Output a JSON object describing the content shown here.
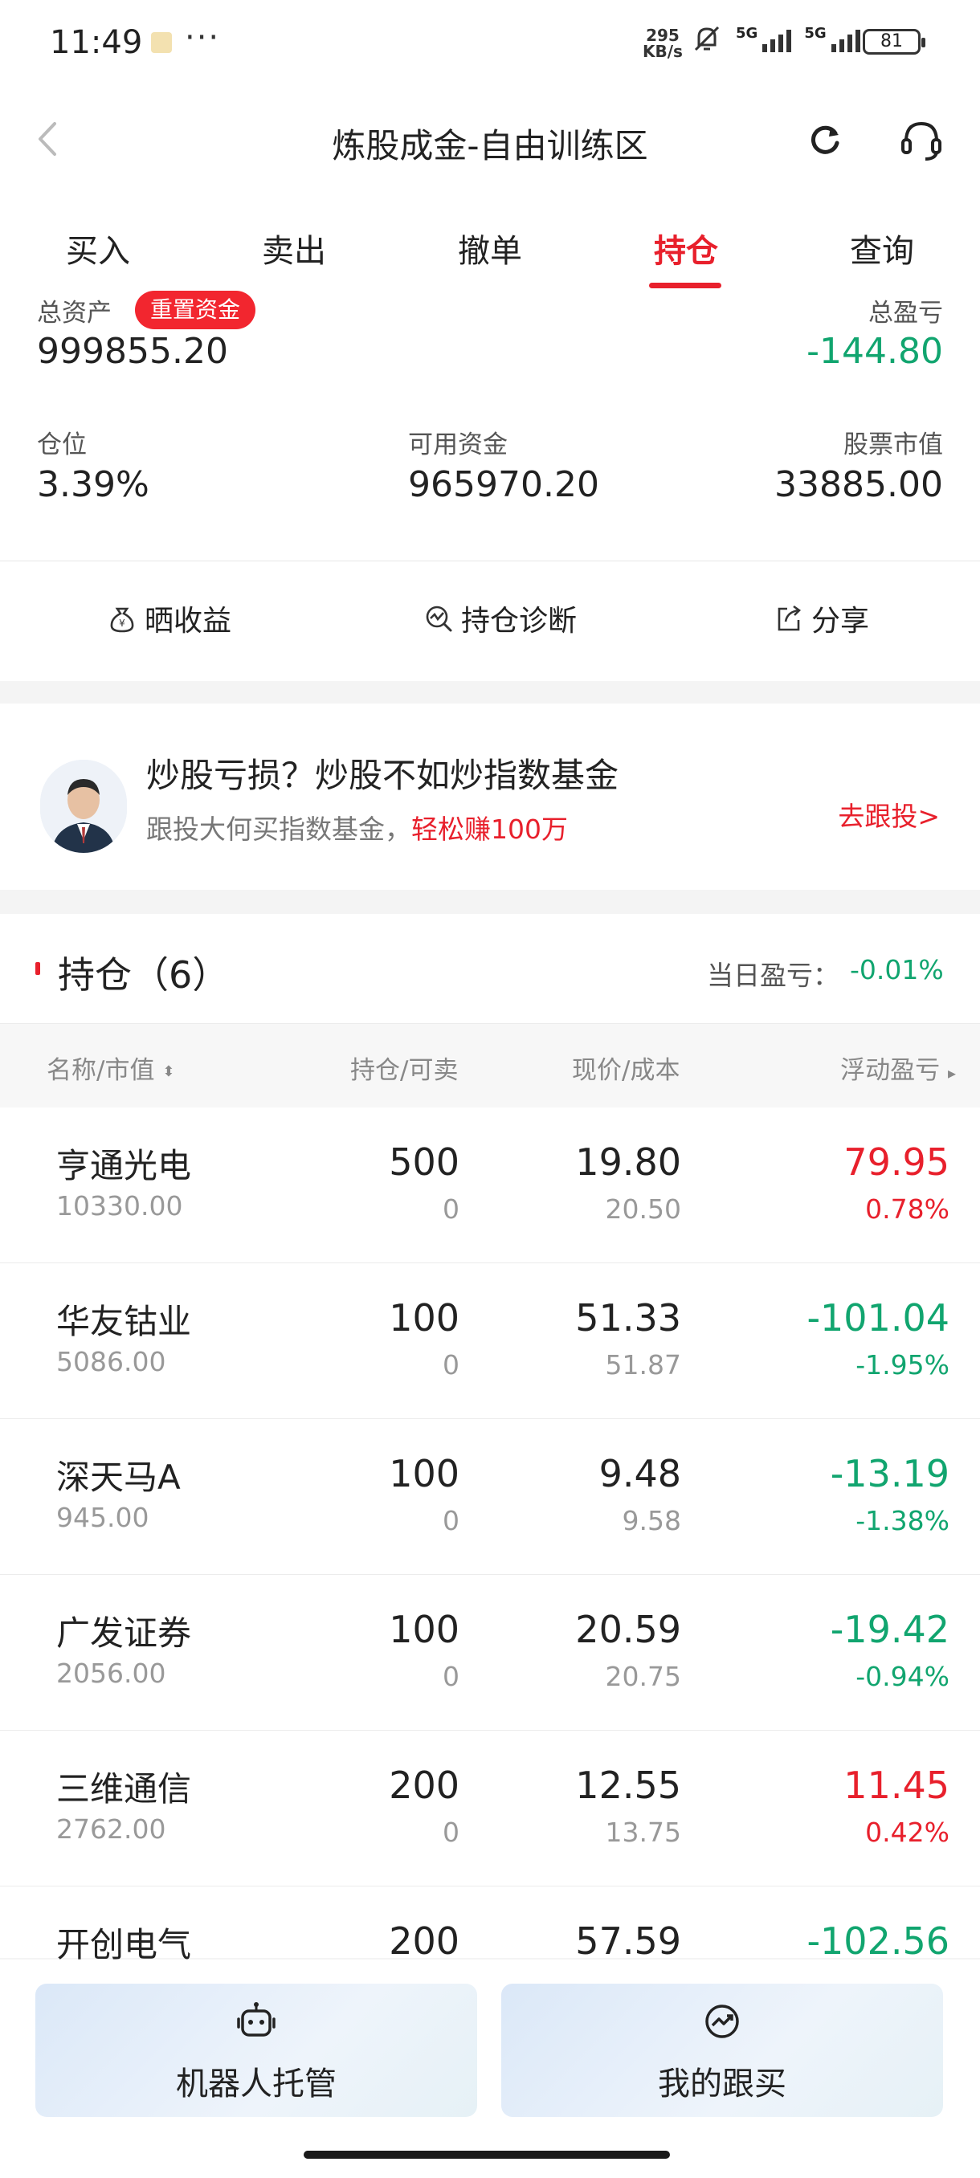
{
  "status_bar": {
    "time": "11:49",
    "dots": "···",
    "net_speed_value": "295",
    "net_speed_unit": "KB/s",
    "signal_label_1": "5G",
    "signal_label_2": "5G",
    "battery": "81"
  },
  "header": {
    "title": "炼股成金-自由训练区"
  },
  "tabs": [
    {
      "label": "买入"
    },
    {
      "label": "卖出"
    },
    {
      "label": "撤单"
    },
    {
      "label": "持仓",
      "active": true
    },
    {
      "label": "查询"
    }
  ],
  "assets": {
    "total_assets_label": "总资产",
    "reset_label": "重置资金",
    "total_assets_value": "999855.20",
    "total_pl_label": "总盈亏",
    "total_pl_value": "-144.80",
    "position_label": "仓位",
    "position_value": "3.39%",
    "available_label": "可用资金",
    "available_value": "965970.20",
    "market_value_label": "股票市值",
    "market_value_value": "33885.00"
  },
  "actions": {
    "show_profit": "晒收益",
    "diagnose": "持仓诊断",
    "share": "分享"
  },
  "banner": {
    "title": "炒股亏损？炒股不如炒指数基金",
    "subtitle": "跟投大何买指数基金，",
    "highlight": "轻松赚100万",
    "link": "去跟投>"
  },
  "holdings": {
    "title": "持仓（6）",
    "daily_pl_label": "当日盈亏：",
    "daily_pl_value": "-0.01%",
    "columns": {
      "name": "名称/市值",
      "qty": "持仓/可卖",
      "price": "现价/成本",
      "pl": "浮动盈亏"
    },
    "rows": [
      {
        "name": "亨通光电",
        "market_value": "10330.00",
        "qty": "500",
        "available": "0",
        "price": "19.80",
        "cost": "20.50",
        "pl": "79.95",
        "pct": "0.78%",
        "dir": "up"
      },
      {
        "name": "华友钴业",
        "market_value": "5086.00",
        "qty": "100",
        "available": "0",
        "price": "51.33",
        "cost": "51.87",
        "pl": "-101.04",
        "pct": "-1.95%",
        "dir": "down"
      },
      {
        "name": "深天马A",
        "market_value": "945.00",
        "qty": "100",
        "available": "0",
        "price": "9.48",
        "cost": "9.58",
        "pl": "-13.19",
        "pct": "-1.38%",
        "dir": "down"
      },
      {
        "name": "广发证券",
        "market_value": "2056.00",
        "qty": "100",
        "available": "0",
        "price": "20.59",
        "cost": "20.75",
        "pl": "-19.42",
        "pct": "-0.94%",
        "dir": "down"
      },
      {
        "name": "三维通信",
        "market_value": "2762.00",
        "qty": "200",
        "available": "0",
        "price": "12.55",
        "cost": "13.75",
        "pl": "11.45",
        "pct": "0.42%",
        "dir": "up"
      },
      {
        "name": "开创电气",
        "market_value": "",
        "qty": "200",
        "available": "",
        "price": "57.59",
        "cost": "",
        "pl": "-102.56",
        "pct": "",
        "dir": "down"
      }
    ]
  },
  "bottom": {
    "robot_label": "机器人托管",
    "follow_label": "我的跟买"
  },
  "colors": {
    "accent_red": "#e8202c",
    "down_green": "#11a56f"
  }
}
